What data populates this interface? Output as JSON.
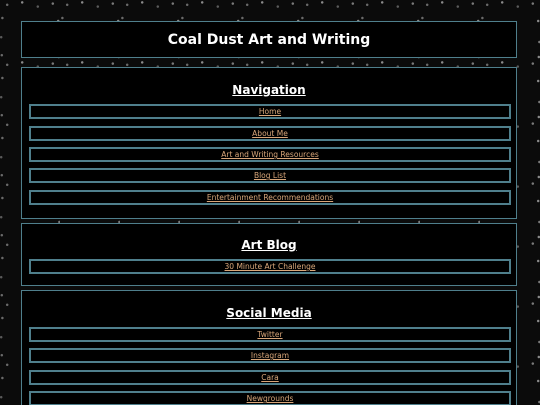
{
  "header": {
    "title": "Coal Dust Art and Writing"
  },
  "navigation": {
    "heading": "Navigation",
    "links": [
      "Home",
      "About Me",
      "Art and Writing Resources",
      "Blog List",
      "Entertainment Recommendations"
    ]
  },
  "art_blog": {
    "heading": "Art Blog",
    "links": [
      "30 Minute Art Challenge"
    ]
  },
  "social_media": {
    "heading": "Social Media",
    "links": [
      "Twitter",
      "Instagram",
      "Cara",
      "Newgrounds"
    ]
  },
  "colors": {
    "background": "#0b0b0b",
    "panel": "#000000",
    "border": "#4f7f8c",
    "link": "#d9a77a",
    "text": "#ffffff"
  }
}
